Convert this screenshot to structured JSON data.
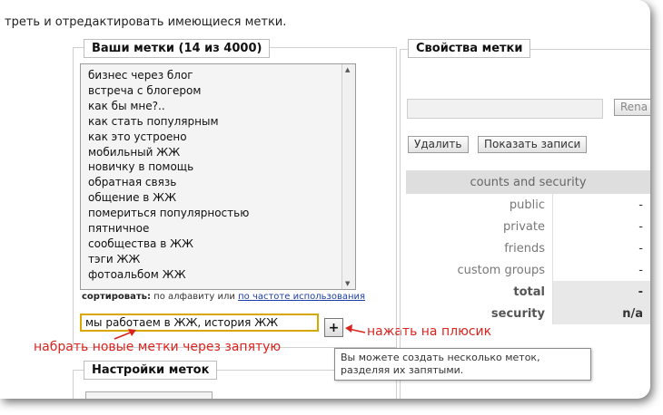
{
  "intro_text": "треть и отредактировать имеющиеся метки.",
  "your_tags": {
    "title": "Ваши метки (14 из 4000)",
    "items": [
      "бизнес через блог",
      "встреча с блогером",
      "как бы мне?..",
      "как стать популярным",
      "как это устроено",
      "мобильный ЖЖ",
      "новичку в помощь",
      "обратная связь",
      "общение в ЖЖ",
      "помериться популярностью",
      "пятничное",
      "сообщества в ЖЖ",
      "тэги ЖЖ",
      "фотоальбом ЖЖ"
    ],
    "sort_label": "сортировать:",
    "sort_alpha": "по алфавиту или",
    "sort_freq": "по частоте использования"
  },
  "new_tags_input_value": "мы работаем в ЖЖ, история ЖЖ",
  "plus_button": "+",
  "annotations": {
    "plus_hint": "нажать на плюсик",
    "input_hint": "набрать новые метки через запятую"
  },
  "tooltip_text": "Вы можете создать несколько меток, разделяя их запятыми.",
  "tag_settings": {
    "title": "Настройки меток"
  },
  "tag_properties": {
    "title": "Свойства метки",
    "rename_button": "Rena",
    "delete_button": "Удалить",
    "show_posts_button": "Показать записи",
    "table_header": "counts and security",
    "rows": [
      {
        "label": "public",
        "value": "-"
      },
      {
        "label": "private",
        "value": "-"
      },
      {
        "label": "friends",
        "value": "-"
      },
      {
        "label": "custom groups",
        "value": "-"
      },
      {
        "label": "total",
        "value": "-"
      },
      {
        "label": "security",
        "value": "n/a"
      }
    ]
  },
  "colors": {
    "annotation": "#d9241f",
    "input_border": "#d8a800",
    "link": "#1a3ea8"
  }
}
